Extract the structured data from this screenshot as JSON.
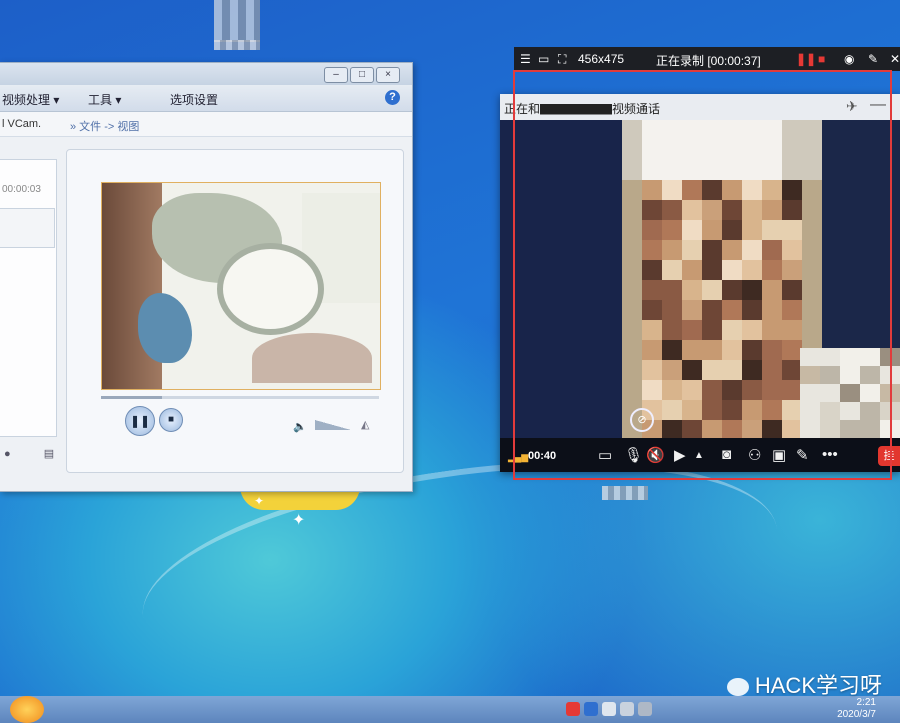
{
  "player": {
    "menu": [
      "视频处理 ▾",
      "工具 ▾",
      "选项设置"
    ],
    "help_label": "?",
    "addr_left": "l VCam.",
    "addr_path": "» 文件 -> 视图",
    "left_time": "00:00:03",
    "play_state": "pause",
    "pause_glyph": "❚❚",
    "stop_glyph": "■",
    "progress": 0.22,
    "volume_icon": "🔈",
    "volume_end": "◭"
  },
  "recorder": {
    "resolution": "456x475",
    "status": "正在录制 [00:00:37]",
    "pause_glyph": "❚❚",
    "stop_glyph": "■",
    "camera_glyph": "◉",
    "pen_glyph": "✎",
    "close_glyph": "✕"
  },
  "call": {
    "title": "正在和▇▇▇▇▇▇视频通话",
    "pin_glyph": "✈",
    "min_glyph": "—",
    "time": "00:40",
    "signal_glyph": "▂▄▆",
    "settings_glyph": "⊘",
    "end_label": "挂"
  },
  "taskbar": {
    "time": "2:21",
    "date": "2020/3/7"
  },
  "watermark": "HACK学习呀"
}
